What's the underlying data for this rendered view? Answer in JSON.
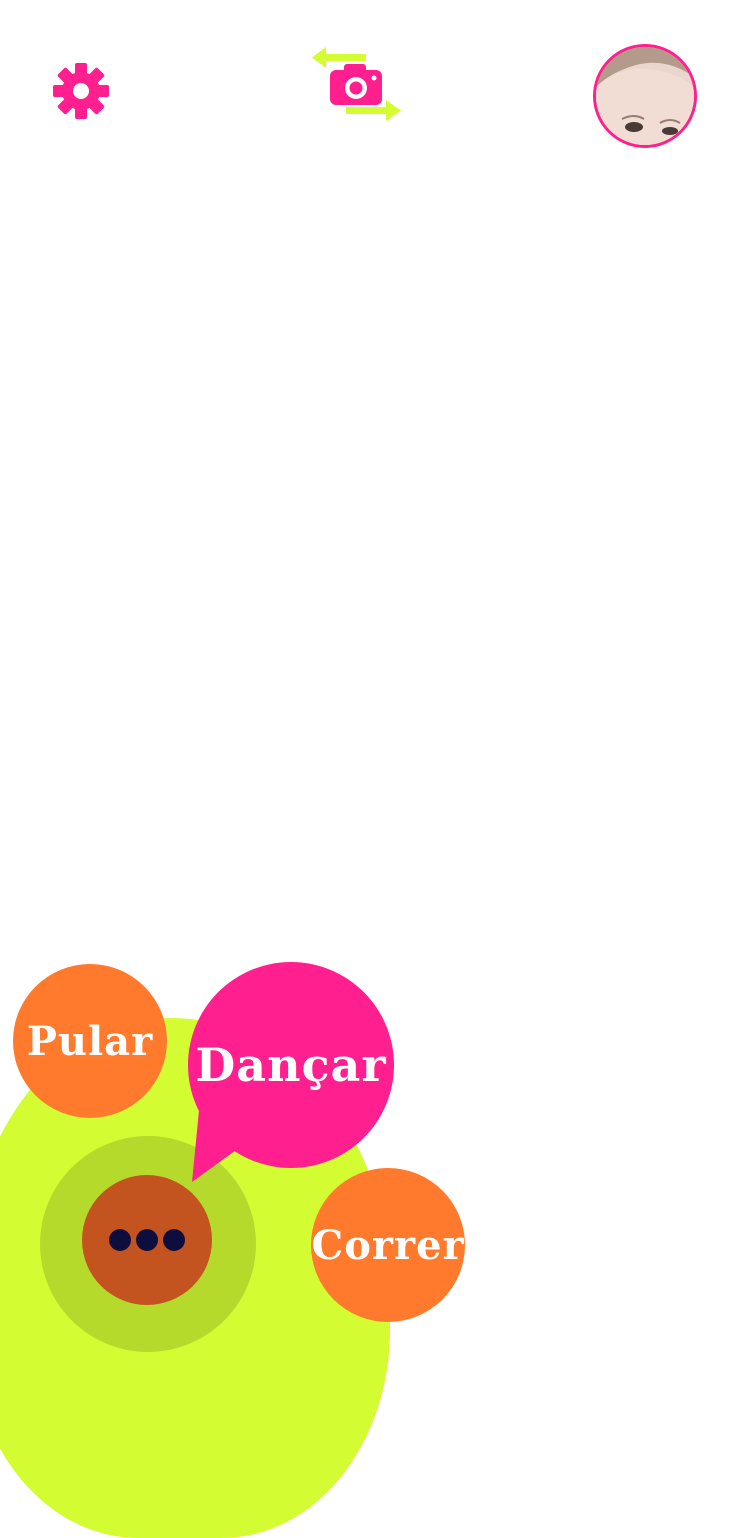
{
  "top_bar": {
    "settings_icon": "gear-icon",
    "camera_switch_icon": "camera-switch-icon",
    "avatar_icon": "user-avatar"
  },
  "actions": {
    "pular": "Pular",
    "dancar": "Dançar",
    "correr": "Correr",
    "more_icon": "ellipsis-icon"
  },
  "colors": {
    "pink": "#ff1f8e",
    "orange": "#ff7a2c",
    "lime": "#d4fc33",
    "lime_dark": "#b6da2c",
    "brown": "#c4541f",
    "navy": "#0e0e3e"
  }
}
